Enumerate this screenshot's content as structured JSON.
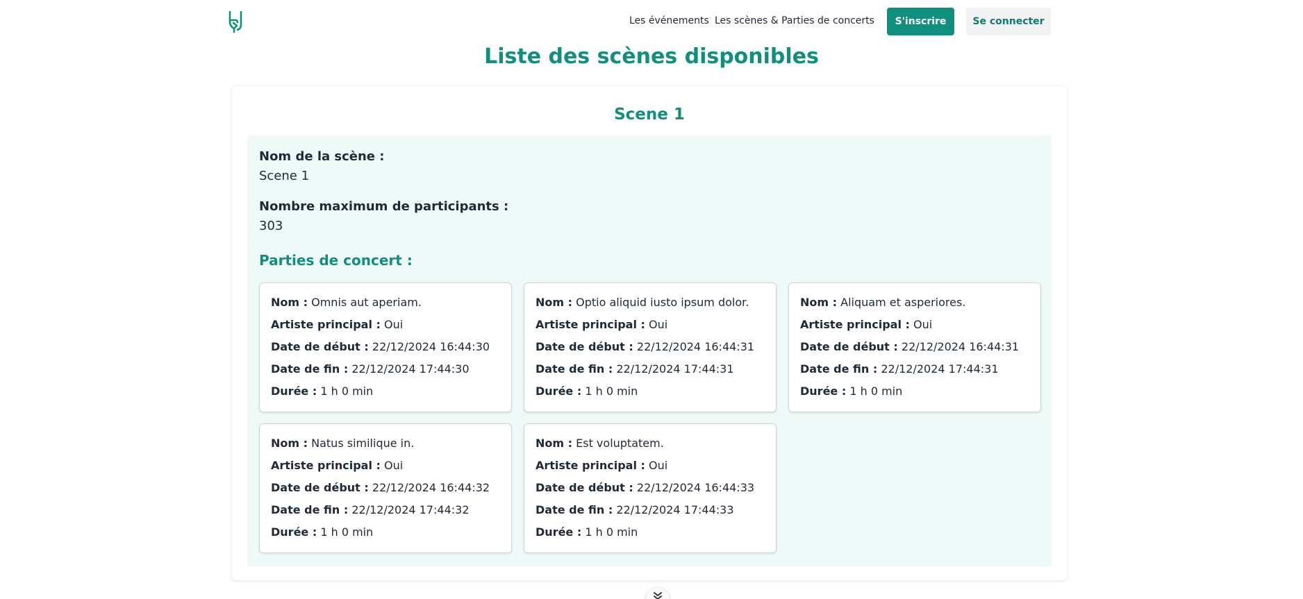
{
  "nav": {
    "events_link": "Les événements",
    "scenes_link": "Les scènes & Parties de concerts",
    "signup_label": "S'inscrire",
    "login_label": "Se connecter",
    "logo_icon": "rock-hand-logo-icon"
  },
  "page": {
    "title": "Liste des scènes disponibles"
  },
  "scene": {
    "title": "Scene 1",
    "name_label": "Nom de la scène :",
    "name_value": "Scene 1",
    "max_label": "Nombre maximum de participants :",
    "max_value": "303",
    "parts_heading": "Parties de concert :"
  },
  "labels": {
    "name": "Nom :",
    "main_artist": "Artiste principal :",
    "start": "Date de début :",
    "end": "Date de fin :",
    "duration": "Durée :"
  },
  "parts": [
    {
      "name": "Omnis aut aperiam.",
      "main_artist": "Oui",
      "start": "22/12/2024 16:44:30",
      "end": "22/12/2024 17:44:30",
      "duration": "1 h 0 min"
    },
    {
      "name": "Optio aliquid iusto ipsum dolor.",
      "main_artist": "Oui",
      "start": "22/12/2024 16:44:31",
      "end": "22/12/2024 17:44:31",
      "duration": "1 h 0 min"
    },
    {
      "name": "Aliquam et asperiores.",
      "main_artist": "Oui",
      "start": "22/12/2024 16:44:31",
      "end": "22/12/2024 17:44:31",
      "duration": "1 h 0 min"
    },
    {
      "name": "Natus similique in.",
      "main_artist": "Oui",
      "start": "22/12/2024 16:44:32",
      "end": "22/12/2024 17:44:32",
      "duration": "1 h 0 min"
    },
    {
      "name": "Est voluptatem.",
      "main_artist": "Oui",
      "start": "22/12/2024 16:44:33",
      "end": "22/12/2024 17:44:33",
      "duration": "1 h 0 min"
    }
  ],
  "colors": {
    "accent": "#0f8f7e",
    "panel_bg": "#effaf8",
    "login_bg": "#f1f3f4"
  },
  "scroll_icon": "chevron-double-down-icon"
}
